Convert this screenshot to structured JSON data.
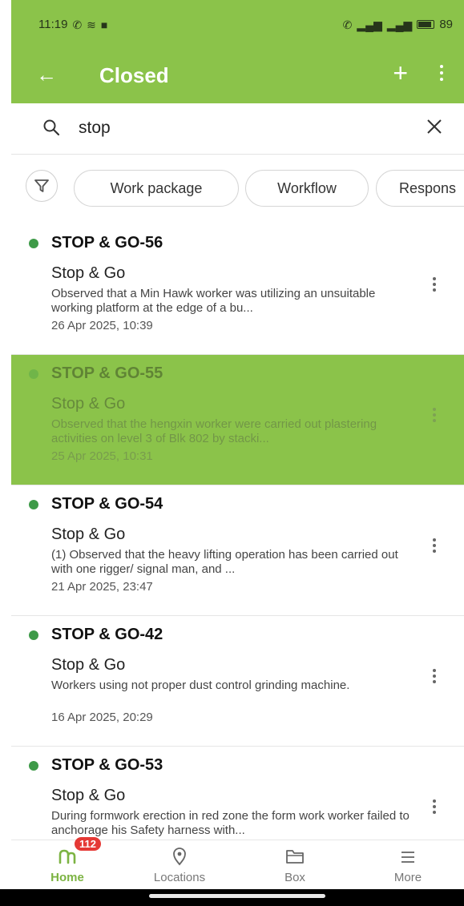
{
  "status_bar": {
    "time": "11:19",
    "battery": "89"
  },
  "app_bar": {
    "title": "Closed"
  },
  "search": {
    "query": "stop"
  },
  "filters": {
    "chips": [
      "Work package",
      "Workflow",
      "Respons"
    ]
  },
  "items": [
    {
      "id": "STOP & GO-56",
      "type": "Stop & Go",
      "description": "Observed that a Min Hawk worker was utilizing an unsuitable working platform at the edge of a bu...",
      "date": "26 Apr 2025, 10:39"
    },
    {
      "id": "STOP & GO-55",
      "type": "Stop & Go",
      "description": "Observed that the hengxin worker were carried out plastering activities on level 3 of Blk 802 by stacki...",
      "date": "25 Apr 2025, 10:31"
    },
    {
      "id": "STOP & GO-54",
      "type": "Stop & Go",
      "description": "(1) Observed that the heavy lifting operation has been carried out with one rigger/ signal man, and ...",
      "date": "21 Apr 2025, 23:47"
    },
    {
      "id": "STOP & GO-42",
      "type": "Stop & Go",
      "description": "Workers using not proper dust control grinding machine.",
      "date": "16 Apr 2025, 20:29"
    },
    {
      "id": "STOP & GO-53",
      "type": "Stop & Go",
      "description": "During formwork erection in red zone the form work worker failed to anchorage his Safety harness with...",
      "date": ""
    }
  ],
  "bottom_nav": {
    "badge": "112",
    "home": "Home",
    "locations": "Locations",
    "box": "Box",
    "more": "More"
  },
  "colors": {
    "primary": "#8bc34a",
    "status_dot": "#3e9a48",
    "badge": "#e53935"
  }
}
